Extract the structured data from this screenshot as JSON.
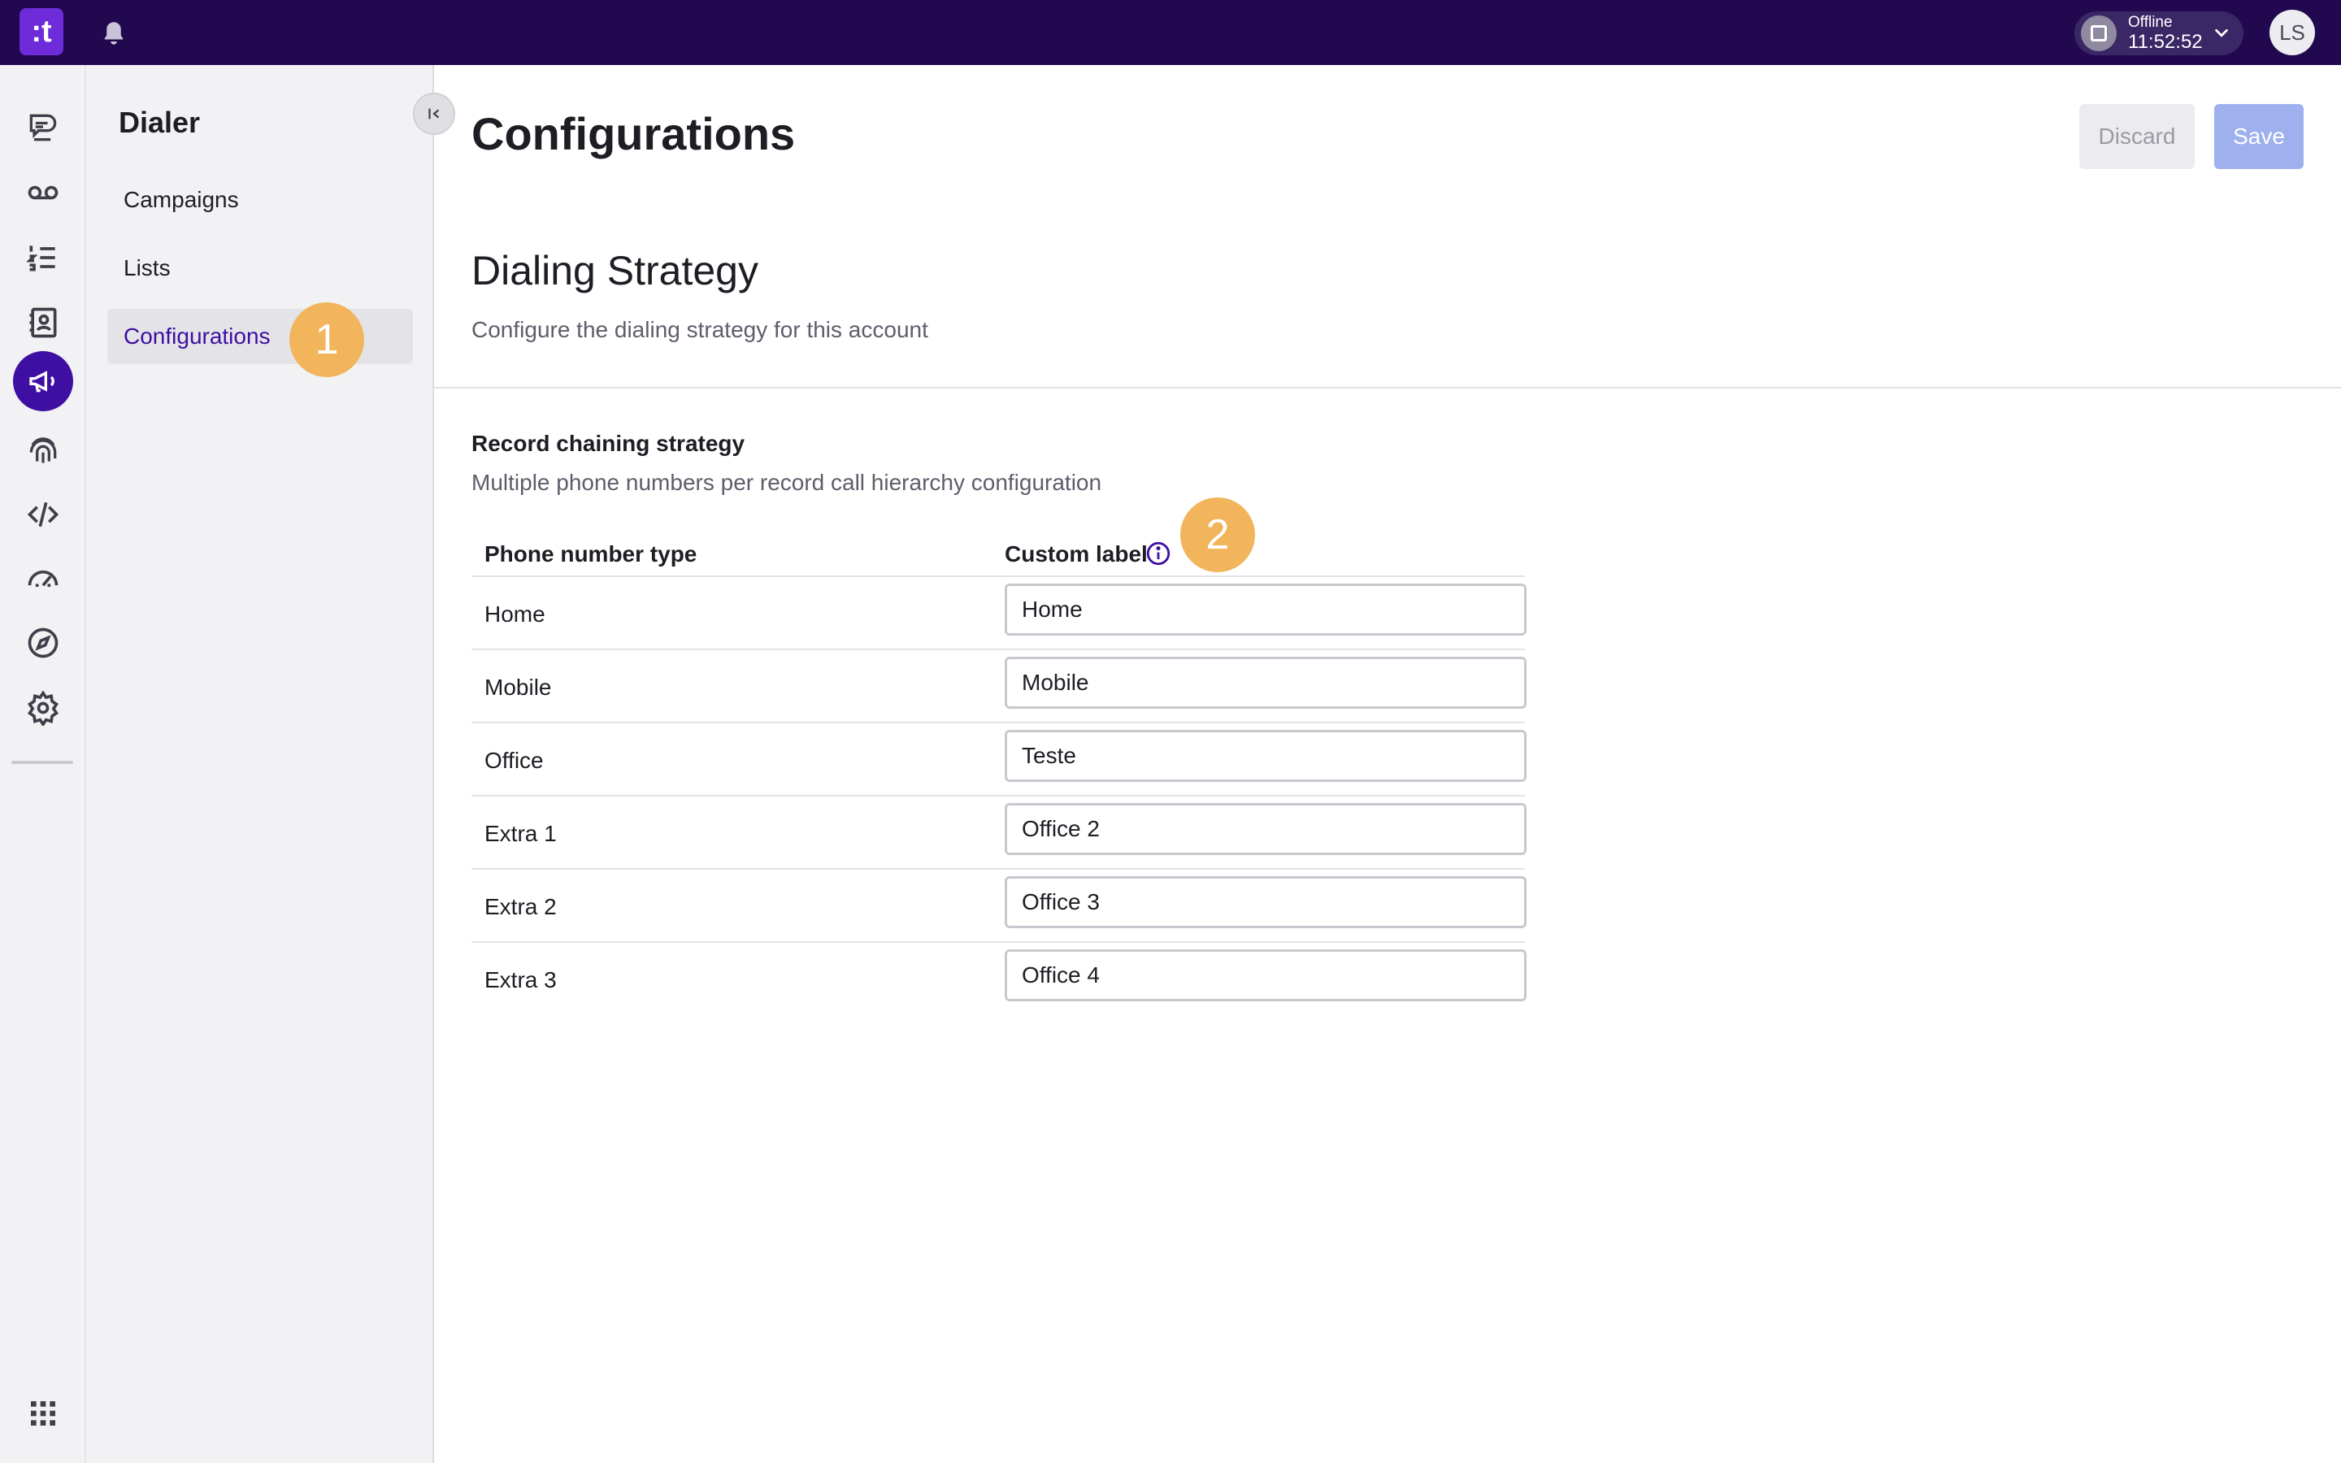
{
  "topbar": {
    "logo_text": ":t",
    "status_label": "Offline",
    "status_time": "11:52:52",
    "avatar_initials": "LS"
  },
  "rail": {
    "icons": [
      "conversations-icon",
      "voicemail-icon",
      "ordered-list-icon",
      "contacts-icon",
      "megaphone-icon",
      "fingerprint-icon",
      "code-icon",
      "dashboard-gauge-icon",
      "compass-icon",
      "settings-gear-icon",
      "apps-grid-icon"
    ],
    "active": "megaphone-icon"
  },
  "sidebar": {
    "title": "Dialer",
    "items": [
      {
        "label": "Campaigns"
      },
      {
        "label": "Lists"
      },
      {
        "label": "Configurations"
      }
    ],
    "active_index": 2
  },
  "header": {
    "title": "Configurations",
    "discard_label": "Discard",
    "save_label": "Save"
  },
  "section": {
    "title": "Dialing Strategy",
    "subtitle": "Configure the dialing strategy for this account"
  },
  "record_chaining": {
    "title": "Record chaining strategy",
    "subtitle": "Multiple phone numbers per record call hierarchy configuration",
    "columns": [
      "Phone number type",
      "Custom label"
    ],
    "rows": [
      {
        "type": "Home",
        "label": "Home"
      },
      {
        "type": "Mobile",
        "label": "Mobile"
      },
      {
        "type": "Office",
        "label": "Teste"
      },
      {
        "type": "Extra 1",
        "label": "Office 2"
      },
      {
        "type": "Extra 2",
        "label": "Office 3"
      },
      {
        "type": "Extra 3",
        "label": "Office 4"
      }
    ]
  },
  "annotations": {
    "badge1": "1",
    "badge2": "2"
  },
  "colors": {
    "topbar": "#22084f",
    "accent": "#3f0ea3",
    "badge": "#f2b55c",
    "save_disabled": "#9fb0ee"
  }
}
